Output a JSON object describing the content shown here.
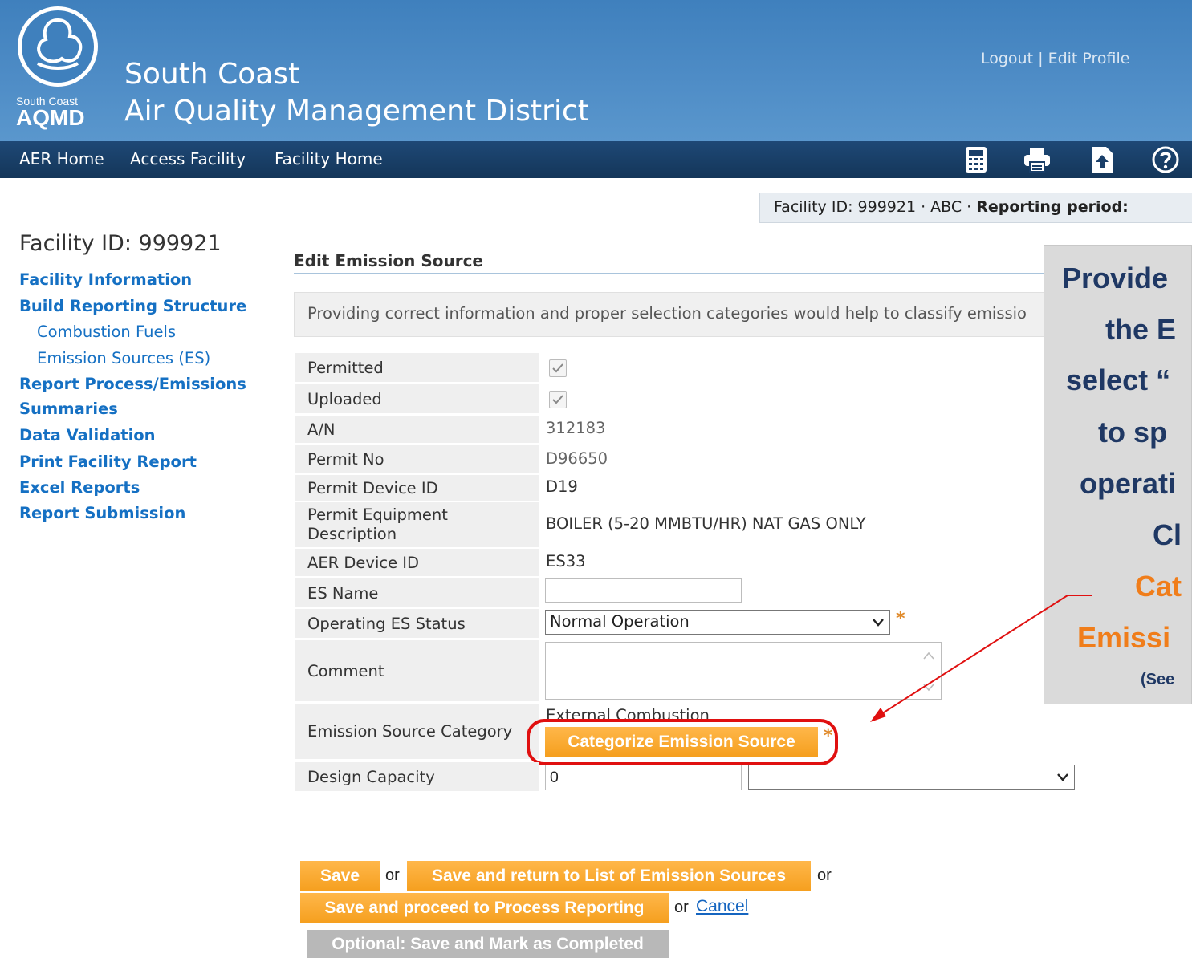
{
  "header": {
    "logo_text_small": "South Coast",
    "logo_text_big": "AQMD",
    "org_line1": "South Coast",
    "org_line2": "Air Quality Management District",
    "logout": "Logout",
    "separator": "|",
    "edit_profile": "Edit Profile"
  },
  "nav": {
    "items": [
      "AER Home",
      "Access Facility",
      "Facility Home"
    ],
    "icons": [
      "calculator-icon",
      "print-icon",
      "upload-icon",
      "help-icon"
    ]
  },
  "facility_bar": {
    "prefix": "Facility ID: 999921 · ABC · ",
    "period_label": "Reporting period:"
  },
  "sidebar": {
    "title": "Facility ID: 999921",
    "links": [
      "Facility Information",
      "Build Reporting Structure",
      "Combustion Fuels",
      "Emission Sources (ES)",
      "Report Process/Emissions",
      "Summaries",
      "Data Validation",
      "Print Facility Report",
      "Excel Reports",
      "Report Submission"
    ]
  },
  "main": {
    "title": "Edit Emission Source",
    "info": "Providing correct information and proper selection categories would help to classify emissio",
    "fields": {
      "permitted": "Permitted",
      "uploaded": "Uploaded",
      "an_label": "A/N",
      "an_value": "312183",
      "permit_no_label": "Permit No",
      "permit_no_value": "D96650",
      "device_id_label": "Permit Device ID",
      "device_id_value": "D19",
      "equip_desc_label": "Permit Equipment Description",
      "equip_desc_value": "BOILER (5-20 MMBTU/HR) NAT GAS ONLY",
      "aer_id_label": "AER Device ID",
      "aer_id_value": "ES33",
      "es_name_label": "ES Name",
      "es_name_value": "",
      "status_label": "Operating ES Status",
      "status_value": "Normal Operation",
      "comment_label": "Comment",
      "comment_value": "",
      "category_label": "Emission Source Category",
      "category_value": "External Combustion",
      "categorize_button": "Categorize Emission Source",
      "capacity_label": "Design Capacity",
      "capacity_value": "0",
      "capacity_unit": ""
    },
    "asterisk": "*"
  },
  "actions": {
    "save": "Save",
    "or": "or",
    "save_return": "Save and return to List of Emission Sources",
    "save_proceed": "Save and proceed to Process Reporting",
    "or_cancel_prefix": "or",
    "cancel": "Cancel",
    "optional": "Optional: Save and Mark as Completed"
  },
  "callout": {
    "lines": [
      "Provide",
      "the E",
      "select “",
      "to sp",
      "operati",
      "Cl",
      "Cat",
      "Emissi",
      "(See"
    ]
  },
  "colors": {
    "header_blue": "#4e8cc6",
    "nav_dark": "#1a3f69",
    "link_blue": "#1570c3",
    "orange_button": "#f7a52a",
    "callout_navy": "#1f3864",
    "callout_orange": "#f07d1a",
    "highlight_red": "#e01010"
  }
}
